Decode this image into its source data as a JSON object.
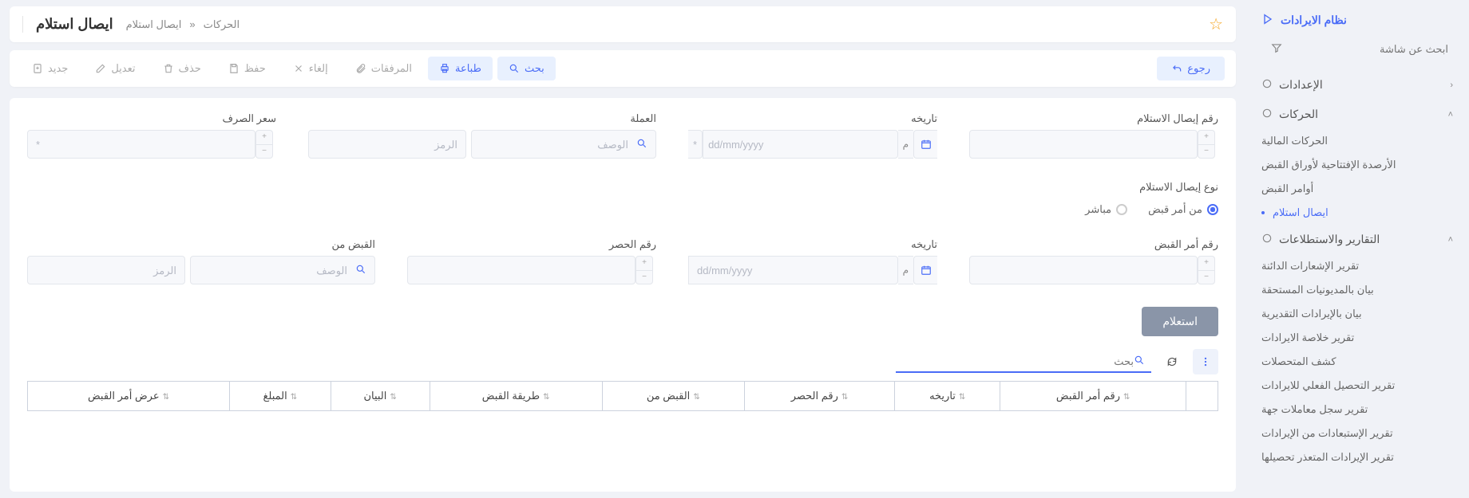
{
  "app_title": "نظام الايرادات",
  "search_placeholder": "ابحث عن شاشة",
  "sidebar": {
    "sections": [
      {
        "title": "الإعدادات",
        "icon": "gear",
        "expanded": false,
        "items": []
      },
      {
        "title": "الحركات",
        "icon": "list",
        "expanded": true,
        "items": [
          {
            "label": "الحركات المالية",
            "active": false
          },
          {
            "label": "الأرصدة الإفتتاحية لأوراق القبض",
            "active": false
          },
          {
            "label": "أوامر القبض",
            "active": false
          },
          {
            "label": "ايصال استلام",
            "active": true
          }
        ]
      },
      {
        "title": "التقارير والاستطلاعات",
        "icon": "report",
        "expanded": true,
        "items": [
          {
            "label": "تقرير الإشعارات الدائنة",
            "active": false
          },
          {
            "label": "بيان بالمديونيات المستحقة",
            "active": false
          },
          {
            "label": "بيان بالإيرادات التقديرية",
            "active": false
          },
          {
            "label": "تقرير خلاصة الايرادات",
            "active": false
          },
          {
            "label": "كشف المتحصلات",
            "active": false
          },
          {
            "label": "تقرير التحصيل الفعلي للايرادات",
            "active": false
          },
          {
            "label": "تقرير سجل معاملات جهة",
            "active": false
          },
          {
            "label": "تقرير الإستبعادات من الإيرادات",
            "active": false
          },
          {
            "label": "تقرير الإيرادات المتعذر تحصيلها",
            "active": false
          }
        ]
      }
    ]
  },
  "breadcrumb": {
    "root": "الحركات",
    "sep": "«",
    "current": "ايصال استلام"
  },
  "page_title": "ايصال استلام",
  "toolbar": {
    "new": "جديد",
    "edit": "تعديل",
    "delete": "حذف",
    "save": "حفظ",
    "cancel": "إلغاء",
    "attachments": "المرفقات",
    "print": "طباعة",
    "search": "بحث",
    "back": "رجوع"
  },
  "form": {
    "receipt_no_label": "رقم إيصال الاستلام",
    "receipt_date_label": "تاريخه",
    "currency_label": "العملة",
    "rate_label": "سعر الصرف",
    "type_label": "نوع إيصال الاستلام",
    "type_from_order": "من أمر قبض",
    "type_direct": "مباشر",
    "order_no_label": "رقم أمر القبض",
    "order_date_label": "تاريخه",
    "restrict_no_label": "رقم الحصر",
    "receive_from_label": "القبض من",
    "query_btn": "استعلام",
    "date_placeholder": "dd/mm/yyyy",
    "date_suffix": "م",
    "code_placeholder": "الرمز",
    "desc_placeholder": "الوصف",
    "asterisk": "*"
  },
  "grid": {
    "search_placeholder": "بحث",
    "columns": [
      "رقم أمر القبض",
      "تاريخه",
      "رقم الحصر",
      "القبض من",
      "طريقة القبض",
      "البيان",
      "المبلغ",
      "عرض أمر القبض"
    ]
  }
}
